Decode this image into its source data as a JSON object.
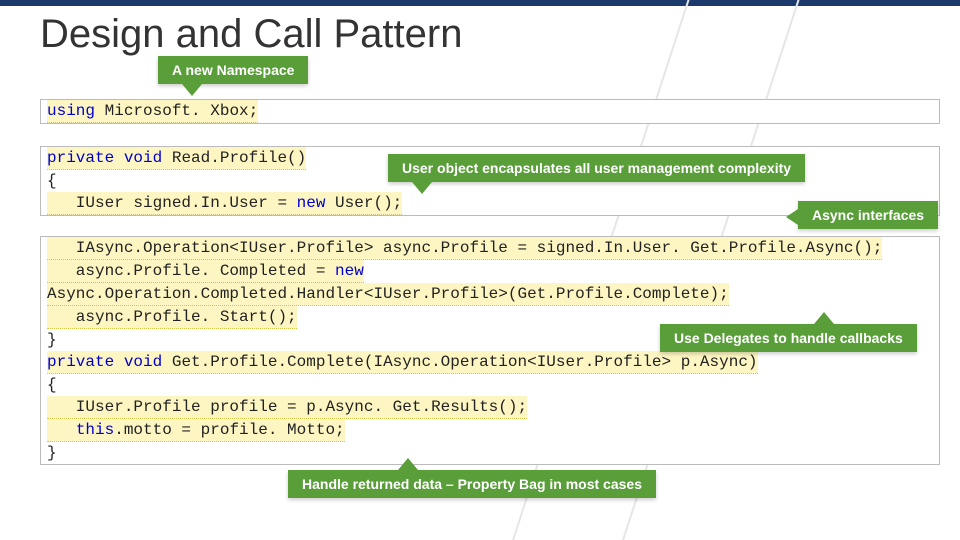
{
  "title": "Design and Call Pattern",
  "callouts": {
    "namespace": "A new Namespace",
    "user_object": "User object encapsulates all user management complexity",
    "async": "Async interfaces",
    "delegates": "Use Delegates to handle callbacks",
    "property_bag": "Handle returned data – Property Bag in most cases"
  },
  "code": {
    "using_kw": "using",
    "using_ns": " Microsoft. Xbox;",
    "priv": "private",
    "void": "void",
    "readprofile": " Read.Profile()",
    "lbrace": "{",
    "rbrace": "}",
    "new": "new",
    "iuser_decl": "   IUser signed.In.User = ",
    "user_ctor": " User();",
    "async_line1a": "   IAsync.Operation<IUser.Profile> async.Profile = signed.In.User. Get.Profile.Async();",
    "async_line2": "   async.Profile. Completed = ",
    "async_line3": "Async.Operation.Completed.Handler<IUser.Profile>(Get.Profile.Complete);",
    "async_line4": "   async.Profile. Start();",
    "getcomplete": " Get.Profile.Complete(IAsync.Operation<IUser.Profile> p.Async)",
    "prof_decl": "   IUser.Profile profile = p.Async. Get.Results();",
    "this": "this",
    "motto": ".motto = profile. Motto;"
  }
}
